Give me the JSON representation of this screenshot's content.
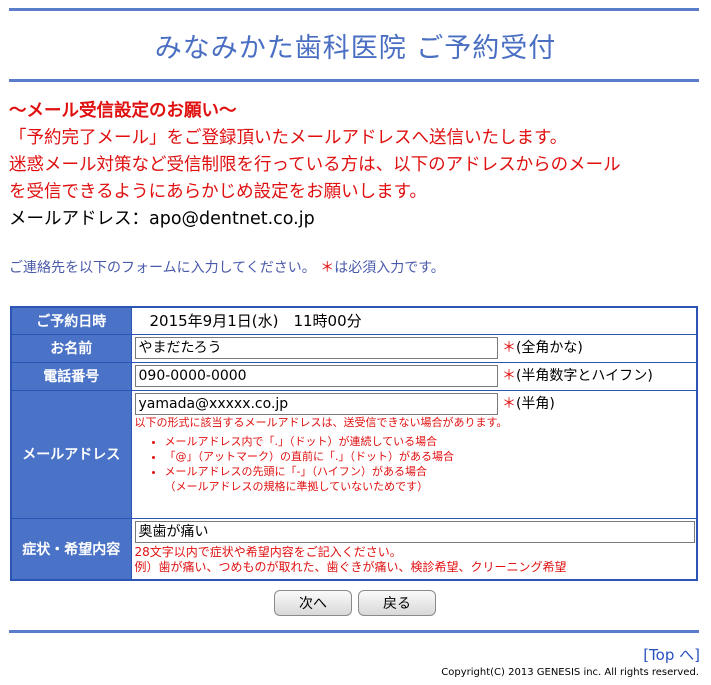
{
  "header": {
    "title": "みなみかた歯科医院 ご予約受付"
  },
  "notice": {
    "heading": "～メール受信設定のお願い～",
    "line1": "「予約完了メール」をご登録頂いたメールアドレスへ送信いたします。",
    "line2": "迷惑メール対策など受信制限を行っている方は、以下のアドレスからのメール",
    "line3": "を受信できるようにあらかじめ設定をお願いします。",
    "address_line": "メールアドレス：apo@dentnet.co.jp"
  },
  "guide": {
    "text": "ご連絡先を以下のフォームに入力してください。",
    "star": "＊",
    "required_text": "は必須入力です。"
  },
  "form": {
    "date": {
      "label": "ご予約日時",
      "value": "2015年9月1日(水)　11時00分"
    },
    "name": {
      "label": "お名前",
      "value": "やまだたろう",
      "hint": "(全角かな)"
    },
    "phone": {
      "label": "電話番号",
      "value": "090-0000-0000",
      "hint": "(半角数字とハイフン)"
    },
    "email": {
      "label": "メールアドレス",
      "value": "yamada@xxxxx.co.jp",
      "hint": "(半角)",
      "warning": "以下の形式に該当するメールアドレスは、送受信できない場合があります。",
      "rules": [
        "メールアドレス内で「.」（ドット）が連続している場合",
        "「@」（アットマーク）の直前に「.」（ドット）がある場合",
        "メールアドレスの先頭に「-」（ハイフン）がある場合"
      ],
      "rule_note": "（メールアドレスの規格に準拠していないためです）"
    },
    "symptom": {
      "label": "症状・希望内容",
      "value": "奥歯が痛い",
      "help1": "28文字以内で症状や希望内容をご記入ください。",
      "help2": "例）歯が痛い、つめものが取れた、歯ぐきが痛い、検診希望、クリーニング希望"
    },
    "required_mark": "＊"
  },
  "buttons": {
    "next": "次へ",
    "back": "戻る"
  },
  "footer": {
    "top_link": "[Top へ]",
    "copyright": "Copyright(C) 2013 GENESIS inc. All rights reserved."
  },
  "colors": {
    "accent": "#4a72c6",
    "title": "#4a6fc2",
    "warning": "#e01010"
  }
}
